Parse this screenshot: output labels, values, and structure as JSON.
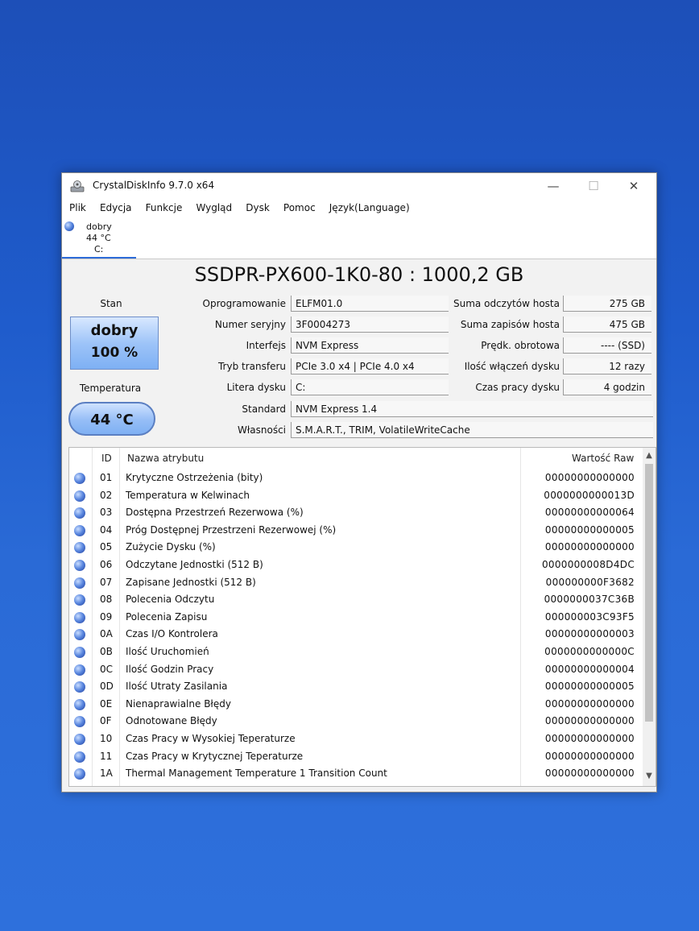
{
  "window": {
    "title": "CrystalDiskInfo 9.7.0 x64",
    "controls": {
      "minimize": "—",
      "maximize": "☐",
      "close": "✕"
    }
  },
  "menu": [
    "Plik",
    "Edycja",
    "Funkcje",
    "Wygląd",
    "Dysk",
    "Pomoc",
    "Język(Language)"
  ],
  "disk_tab": {
    "status": "dobry",
    "temp": "44 °C",
    "letter": "C:"
  },
  "model_title": "SSDPR-PX600-1K0-80 : 1000,2 GB",
  "left_panel": {
    "stan_label": "Stan",
    "status_word": "dobry",
    "status_percent": "100 %",
    "temp_label": "Temperatura",
    "temp_value": "44 °C"
  },
  "info": {
    "firmware_label": "Oprogramowanie",
    "firmware": "ELFM01.0",
    "serial_label": "Numer seryjny",
    "serial": "3F0004273",
    "interface_label": "Interfejs",
    "interface": "NVM Express",
    "transfer_label": "Tryb transferu",
    "transfer": "PCIe 3.0 x4 | PCIe 4.0 x4",
    "letter_label": "Litera dysku",
    "letter": "C:",
    "standard_label": "Standard",
    "standard": "NVM Express 1.4",
    "features_label": "Własności",
    "features": "S.M.A.R.T., TRIM, VolatileWriteCache"
  },
  "right_info": {
    "reads_label": "Suma odczytów hosta",
    "reads": "275 GB",
    "writes_label": "Suma zapisów hosta",
    "writes": "475 GB",
    "rpm_label": "Prędk. obrotowa",
    "rpm": "---- (SSD)",
    "power_count_label": "Ilość włączeń dysku",
    "power_count": "12 razy",
    "power_hours_label": "Czas pracy dysku",
    "power_hours": "4 godzin"
  },
  "table": {
    "col_id": "ID",
    "col_name": "Nazwa atrybutu",
    "col_raw": "Wartość Raw",
    "rows": [
      {
        "id": "01",
        "name": "Krytyczne Ostrzeżenia (bity)",
        "raw": "00000000000000"
      },
      {
        "id": "02",
        "name": "Temperatura w Kelwinach",
        "raw": "0000000000013D"
      },
      {
        "id": "03",
        "name": "Dostępna Przestrzeń Rezerwowa (%)",
        "raw": "00000000000064"
      },
      {
        "id": "04",
        "name": "Próg Dostępnej Przestrzeni Rezerwowej (%)",
        "raw": "00000000000005"
      },
      {
        "id": "05",
        "name": "Zużycie Dysku (%)",
        "raw": "00000000000000"
      },
      {
        "id": "06",
        "name": "Odczytane Jednostki (512 B)",
        "raw": "0000000008D4DC"
      },
      {
        "id": "07",
        "name": "Zapisane Jednostki (512 B)",
        "raw": "000000000F3682"
      },
      {
        "id": "08",
        "name": "Polecenia Odczytu",
        "raw": "0000000037C36B"
      },
      {
        "id": "09",
        "name": "Polecenia Zapisu",
        "raw": "000000003C93F5"
      },
      {
        "id": "0A",
        "name": "Czas I/O Kontrolera",
        "raw": "00000000000003"
      },
      {
        "id": "0B",
        "name": "Ilość Uruchomień",
        "raw": "0000000000000C"
      },
      {
        "id": "0C",
        "name": "Ilość Godzin Pracy",
        "raw": "00000000000004"
      },
      {
        "id": "0D",
        "name": "Ilość Utraty Zasilania",
        "raw": "00000000000005"
      },
      {
        "id": "0E",
        "name": "Nienaprawialne Błędy",
        "raw": "00000000000000"
      },
      {
        "id": "0F",
        "name": "Odnotowane Błędy",
        "raw": "00000000000000"
      },
      {
        "id": "10",
        "name": "Czas Pracy w Wysokiej Teperaturze",
        "raw": "00000000000000"
      },
      {
        "id": "11",
        "name": "Czas Pracy w Krytycznej Teperaturze",
        "raw": "00000000000000"
      },
      {
        "id": "1A",
        "name": "Thermal Management Temperature 1 Transition Count",
        "raw": "00000000000000"
      }
    ]
  }
}
